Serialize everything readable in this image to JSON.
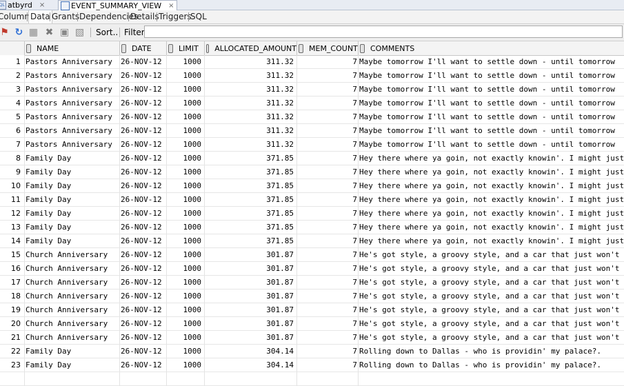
{
  "editor_tabs": [
    {
      "label": "atbyrd",
      "close": "×"
    },
    {
      "label": "EVENT_SUMMARY_VIEW",
      "close": "×"
    }
  ],
  "sub_tabs": [
    "Columns",
    "Data",
    "Grants",
    "Dependencies",
    "Details",
    "Triggers",
    "SQL"
  ],
  "toolbar": {
    "icons": [
      "pin-icon",
      "refresh-icon",
      "insert-row-icon",
      "delete-icon",
      "commit-icon",
      "rollback-icon"
    ],
    "sort_label": "Sort..",
    "filter_label": "Filter:",
    "filter_value": ""
  },
  "columns": [
    "NAME",
    "DATE",
    "LIMIT",
    "ALLOCATED_AMOUNT",
    "MEM_COUNT",
    "COMMENTS"
  ],
  "rows": [
    {
      "n": "1",
      "name": "Pastors Anniversary",
      "date": "26-NOV-12",
      "limit": "1000",
      "amount": "311.32",
      "mem": "7",
      "comment": "Maybe tomorrow I'll want to settle down - until tomorrow"
    },
    {
      "n": "2",
      "name": "Pastors Anniversary",
      "date": "26-NOV-12",
      "limit": "1000",
      "amount": "311.32",
      "mem": "7",
      "comment": "Maybe tomorrow I'll want to settle down - until tomorrow"
    },
    {
      "n": "3",
      "name": "Pastors Anniversary",
      "date": "26-NOV-12",
      "limit": "1000",
      "amount": "311.32",
      "mem": "7",
      "comment": "Maybe tomorrow I'll want to settle down - until tomorrow"
    },
    {
      "n": "4",
      "name": "Pastors Anniversary",
      "date": "26-NOV-12",
      "limit": "1000",
      "amount": "311.32",
      "mem": "7",
      "comment": "Maybe tomorrow I'll want to settle down - until tomorrow"
    },
    {
      "n": "5",
      "name": "Pastors Anniversary",
      "date": "26-NOV-12",
      "limit": "1000",
      "amount": "311.32",
      "mem": "7",
      "comment": "Maybe tomorrow I'll want to settle down - until tomorrow"
    },
    {
      "n": "6",
      "name": "Pastors Anniversary",
      "date": "26-NOV-12",
      "limit": "1000",
      "amount": "311.32",
      "mem": "7",
      "comment": "Maybe tomorrow I'll want to settle down - until tomorrow"
    },
    {
      "n": "7",
      "name": "Pastors Anniversary",
      "date": "26-NOV-12",
      "limit": "1000",
      "amount": "311.32",
      "mem": "7",
      "comment": "Maybe tomorrow I'll want to settle down - until tomorrow"
    },
    {
      "n": "8",
      "name": "Family Day",
      "date": "26-NOV-12",
      "limit": "1000",
      "amount": "371.85",
      "mem": "7",
      "comment": "Hey there where ya goin, not exactly knowin'. I might just"
    },
    {
      "n": "9",
      "name": "Family Day",
      "date": "26-NOV-12",
      "limit": "1000",
      "amount": "371.85",
      "mem": "7",
      "comment": "Hey there where ya goin, not exactly knowin'. I might just"
    },
    {
      "n": "10",
      "name": "Family Day",
      "date": "26-NOV-12",
      "limit": "1000",
      "amount": "371.85",
      "mem": "7",
      "comment": "Hey there where ya goin, not exactly knowin'. I might just"
    },
    {
      "n": "11",
      "name": "Family Day",
      "date": "26-NOV-12",
      "limit": "1000",
      "amount": "371.85",
      "mem": "7",
      "comment": "Hey there where ya goin, not exactly knowin'. I might just"
    },
    {
      "n": "12",
      "name": "Family Day",
      "date": "26-NOV-12",
      "limit": "1000",
      "amount": "371.85",
      "mem": "7",
      "comment": "Hey there where ya goin, not exactly knowin'. I might just"
    },
    {
      "n": "13",
      "name": "Family Day",
      "date": "26-NOV-12",
      "limit": "1000",
      "amount": "371.85",
      "mem": "7",
      "comment": "Hey there where ya goin, not exactly knowin'. I might just"
    },
    {
      "n": "14",
      "name": "Family Day",
      "date": "26-NOV-12",
      "limit": "1000",
      "amount": "371.85",
      "mem": "7",
      "comment": "Hey there where ya goin, not exactly knowin'. I might just"
    },
    {
      "n": "15",
      "name": "Church Anniversary",
      "date": "26-NOV-12",
      "limit": "1000",
      "amount": "301.87",
      "mem": "7",
      "comment": "He's got style, a groovy style, and a car that just won't stop"
    },
    {
      "n": "16",
      "name": "Church Anniversary",
      "date": "26-NOV-12",
      "limit": "1000",
      "amount": "301.87",
      "mem": "7",
      "comment": "He's got style, a groovy style, and a car that just won't stop"
    },
    {
      "n": "17",
      "name": "Church Anniversary",
      "date": "26-NOV-12",
      "limit": "1000",
      "amount": "301.87",
      "mem": "7",
      "comment": "He's got style, a groovy style, and a car that just won't stop"
    },
    {
      "n": "18",
      "name": "Church Anniversary",
      "date": "26-NOV-12",
      "limit": "1000",
      "amount": "301.87",
      "mem": "7",
      "comment": "He's got style, a groovy style, and a car that just won't stop"
    },
    {
      "n": "19",
      "name": "Church Anniversary",
      "date": "26-NOV-12",
      "limit": "1000",
      "amount": "301.87",
      "mem": "7",
      "comment": "He's got style, a groovy style, and a car that just won't stop"
    },
    {
      "n": "20",
      "name": "Church Anniversary",
      "date": "26-NOV-12",
      "limit": "1000",
      "amount": "301.87",
      "mem": "7",
      "comment": "He's got style, a groovy style, and a car that just won't stop"
    },
    {
      "n": "21",
      "name": "Church Anniversary",
      "date": "26-NOV-12",
      "limit": "1000",
      "amount": "301.87",
      "mem": "7",
      "comment": "He's got style, a groovy style, and a car that just won't stop"
    },
    {
      "n": "22",
      "name": "Family Day",
      "date": "26-NOV-12",
      "limit": "1000",
      "amount": "304.14",
      "mem": "7",
      "comment": "Rolling  down to Dallas - who is providin' my palace?."
    },
    {
      "n": "23",
      "name": "Family Day",
      "date": "26-NOV-12",
      "limit": "1000",
      "amount": "304.14",
      "mem": "7",
      "comment": "Rolling  down to Dallas - who is providin' my palace?."
    }
  ],
  "colors": {
    "tab_icon": "#3d6db5",
    "pin": "#c0392b",
    "refresh": "#2f6fd6",
    "disabled": "#8a8a8a"
  }
}
